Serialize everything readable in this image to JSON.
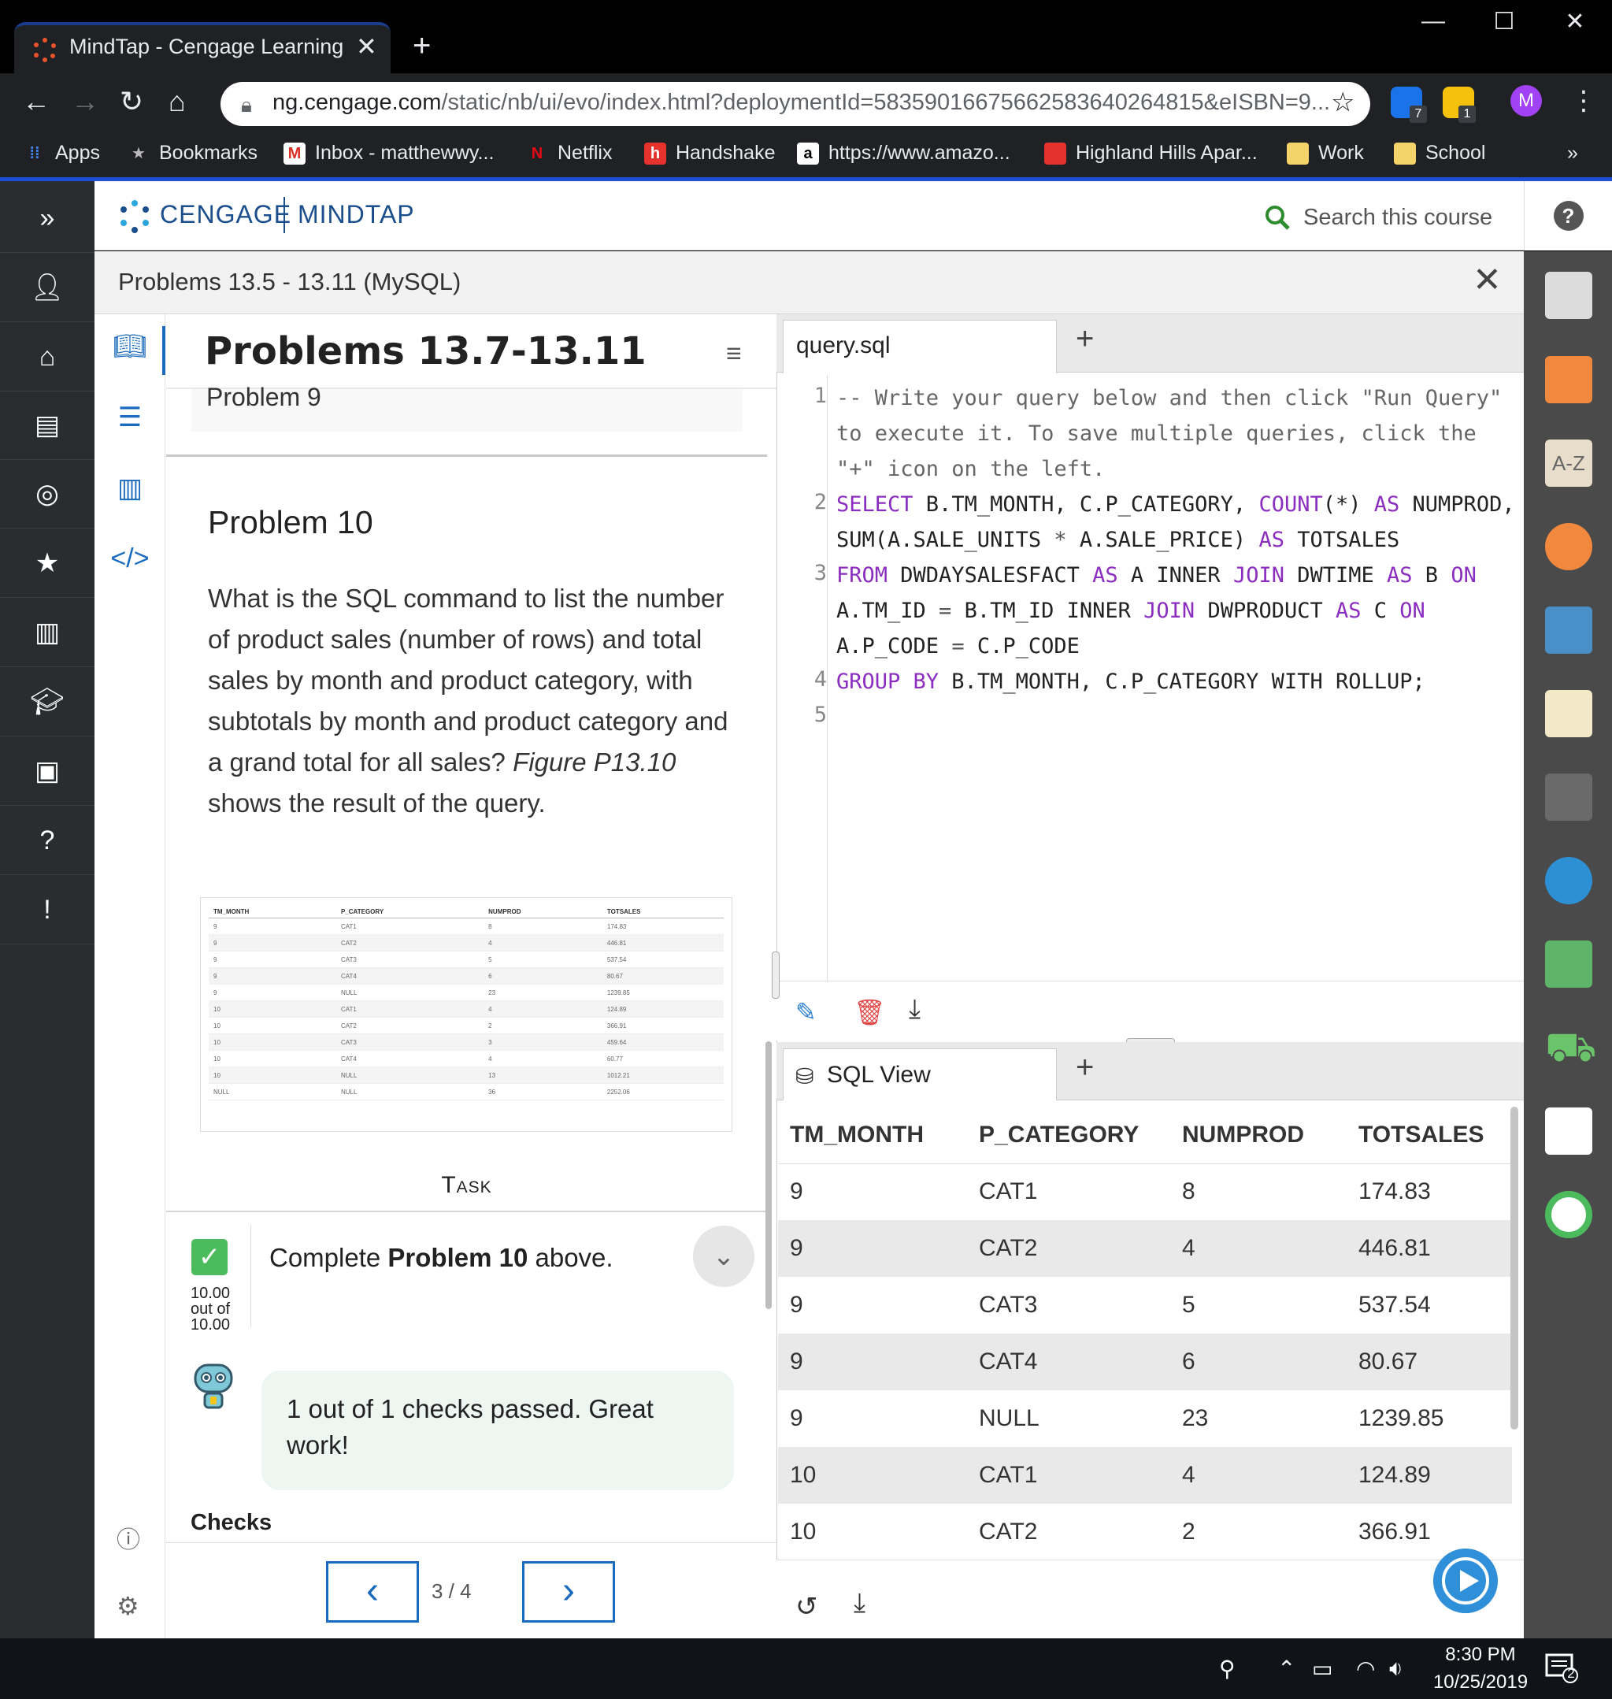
{
  "browser": {
    "tab_title": "MindTap - Cengage Learning",
    "url_host": "ng.cengage.com",
    "url_path": "/static/nb/ui/evo/index.html?deploymentId=5835901667566258364026481​5&eISBN=9...",
    "ext_badge_1": "7",
    "ext_badge_2": "1",
    "avatar_letter": "M",
    "bookmarks": [
      "Apps",
      "Bookmarks",
      "Inbox - matthewwy...",
      "Netflix",
      "Handshake",
      "https://www.amazo...",
      "Highland Hills Apar...",
      "Work",
      "School"
    ]
  },
  "header": {
    "brand_left": "CENGAGE",
    "brand_right": "MINDTAP",
    "search_placeholder": "Search this course"
  },
  "subheader": {
    "title": "Problems 13.5 - 13.11 (MySQL)"
  },
  "lesson": {
    "title": "Problems 13.7-13.11",
    "previous_problem": "Problem 9",
    "problem_heading": "Problem 10",
    "problem_text_1": "What is the SQL command to list the number of product sales (number of rows) and total sales by month and product category, with subtotals by month and product category and a grand total for all sales?",
    "problem_text_fig": "Figure P13.10",
    "problem_text_2": "shows the result of the query.",
    "task_label": "Task",
    "task_text_pre": "Complete",
    "task_text_bold": "Problem 10",
    "task_text_post": "above.",
    "score_line1": "10.00",
    "score_line2": "out of",
    "score_line3": "10.00",
    "feedback": "1 out of 1 checks passed. Great work!",
    "checks_label": "Checks",
    "page_indicator": "3 / 4"
  },
  "figure": {
    "headers": [
      "TM_MONTH",
      "P_CATEGORY",
      "NUMPROD",
      "TOTSALES"
    ],
    "rows": [
      [
        "9",
        "CAT1",
        "8",
        "174.83"
      ],
      [
        "9",
        "CAT2",
        "4",
        "446.81"
      ],
      [
        "9",
        "CAT3",
        "5",
        "537.54"
      ],
      [
        "9",
        "CAT4",
        "6",
        "80.67"
      ],
      [
        "9",
        "NULL",
        "23",
        "1239.85"
      ],
      [
        "10",
        "CAT1",
        "4",
        "124.89"
      ],
      [
        "10",
        "CAT2",
        "2",
        "366.91"
      ],
      [
        "10",
        "CAT3",
        "3",
        "459.64"
      ],
      [
        "10",
        "CAT4",
        "4",
        "60.77"
      ],
      [
        "10",
        "NULL",
        "13",
        "1012.21"
      ],
      [
        "NULL",
        "NULL",
        "36",
        "2252.06"
      ]
    ]
  },
  "editor": {
    "tab_label": "query.sql",
    "line_numbers": [
      "1",
      "",
      "",
      "2",
      "",
      "3",
      "",
      "",
      "4",
      "5"
    ]
  },
  "results": {
    "tab_label": "SQL View",
    "headers": [
      "TM_MONTH",
      "P_CATEGORY",
      "NUMPROD",
      "TOTSALES"
    ],
    "rows": [
      [
        "9",
        "CAT1",
        "8",
        "174.83"
      ],
      [
        "9",
        "CAT2",
        "4",
        "446.81"
      ],
      [
        "9",
        "CAT3",
        "5",
        "537.54"
      ],
      [
        "9",
        "CAT4",
        "6",
        "80.67"
      ],
      [
        "9",
        "NULL",
        "23",
        "1239.85"
      ],
      [
        "10",
        "CAT1",
        "4",
        "124.89"
      ],
      [
        "10",
        "CAT2",
        "2",
        "366.91"
      ]
    ]
  },
  "taskbar": {
    "time": "8:30 PM",
    "date": "10/25/2019",
    "notifications": "2"
  }
}
